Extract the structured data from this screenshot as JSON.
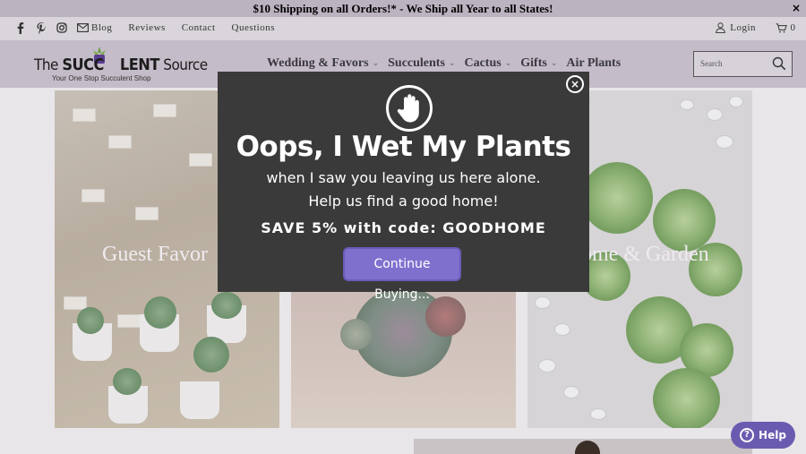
{
  "announcement": {
    "text": "$10 Shipping on all Orders!* - We Ship all Year to all States!",
    "close": "×"
  },
  "topbar": {
    "social_icons": [
      "facebook-icon",
      "pinterest-icon",
      "instagram-icon",
      "mail-icon"
    ],
    "links": [
      "Blog",
      "Reviews",
      "Contact",
      "Questions"
    ],
    "login": "Login",
    "cart_count": "0"
  },
  "header": {
    "logo_brand_pre": "The ",
    "logo_brand_main": "SUCC",
    "logo_brand_mid": "LENT",
    "logo_brand_post": " Source",
    "logo_tagline": "Your One Stop Succulent Shop",
    "nav": [
      "Wedding & Favors",
      "Succulents",
      "Cactus",
      "Gifts",
      "Air Plants"
    ],
    "search_placeholder": "Search"
  },
  "tiles": {
    "tile1_label": "Guest Favor",
    "tile3_label": "ome & Garden"
  },
  "modal": {
    "title": "Oops, I Wet My Plants",
    "line1": "when I saw you leaving us here alone.",
    "line2": "Help us find a good home!",
    "code_line": "SAVE 5% with code: GOODHOME",
    "button": "Continue Buying...",
    "close": "×"
  },
  "help": {
    "label": "Help"
  },
  "colors": {
    "accent": "#8070ce",
    "modal_bg": "#3a3a3a",
    "help_bg": "#6b5bb0"
  }
}
